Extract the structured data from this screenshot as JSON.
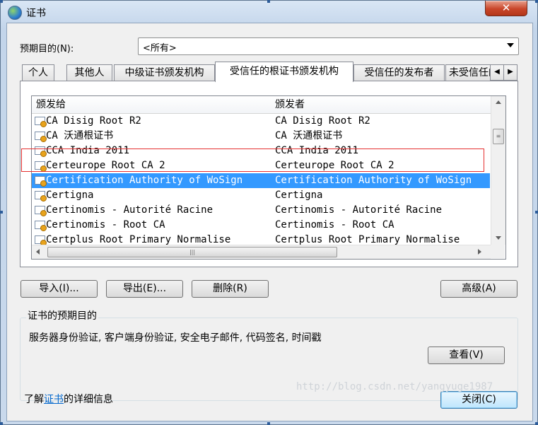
{
  "window": {
    "title": "证书",
    "close_glyph": "✕"
  },
  "purpose": {
    "label": "预期目的(N):",
    "value": "<所有>"
  },
  "tabs": [
    {
      "label": "个人"
    },
    {
      "label": "其他人"
    },
    {
      "label": "中级证书颁发机构"
    },
    {
      "label": "受信任的根证书颁发机构",
      "active": true
    },
    {
      "label": "受信任的发布者"
    },
    {
      "label": "未受信任的发布者"
    }
  ],
  "tab_scroll": {
    "left": "◀",
    "right": "▶"
  },
  "list": {
    "columns": [
      "颁发给",
      "颁发者"
    ],
    "rows": [
      {
        "issued_to": "CA Disig Root R2",
        "issued_by": "CA Disig Root R2"
      },
      {
        "issued_to": "CA 沃通根证书",
        "issued_by": "CA 沃通根证书"
      },
      {
        "issued_to": "CCA India 2011",
        "issued_by": "CCA India 2011"
      },
      {
        "issued_to": "Certeurope Root CA 2",
        "issued_by": "Certeurope Root CA 2"
      },
      {
        "issued_to": "Certification Authority of WoSign",
        "issued_by": "Certification Authority of WoSign",
        "selected": true
      },
      {
        "issued_to": "Certigna",
        "issued_by": "Certigna"
      },
      {
        "issued_to": "Certinomis - Autorité Racine",
        "issued_by": "Certinomis - Autorité Racine"
      },
      {
        "issued_to": "Certinomis - Root CA",
        "issued_by": "Certinomis - Root CA"
      },
      {
        "issued_to": "Certplus Root Primary Normalise",
        "issued_by": "Certplus Root Primary Normalise"
      }
    ],
    "selected_color": "#3399ff"
  },
  "buttons": {
    "import": "导入(I)...",
    "export": "导出(E)...",
    "remove": "删除(R)",
    "advanced": "高级(A)",
    "view": "查看(V)",
    "close": "关闭(C)"
  },
  "purposes_group": {
    "title": "证书的预期目的",
    "text": "服务器身份验证, 客户端身份验证, 安全电子邮件, 代码签名, 时间戳"
  },
  "footer": {
    "prefix": "了解",
    "link": "证书",
    "suffix": "的详细信息"
  },
  "watermark": "http://blog.csdn.net/yangyuge1987"
}
